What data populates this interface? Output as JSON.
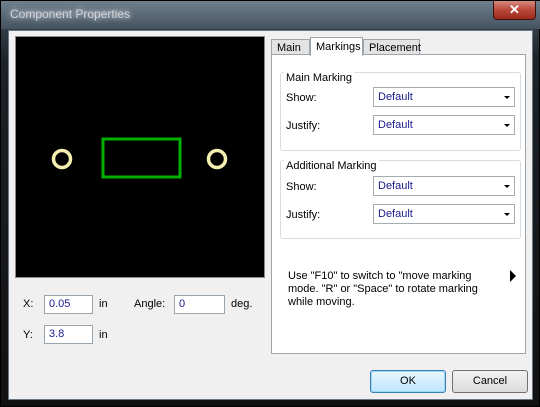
{
  "window": {
    "title": "Component Properties",
    "close_glyph": "✕"
  },
  "coords": {
    "x_label": "X:",
    "x_value": "0.05",
    "x_unit": "in",
    "y_label": "Y:",
    "y_value": "3.8",
    "y_unit": "in",
    "angle_label": "Angle:",
    "angle_value": "0",
    "angle_unit": "deg."
  },
  "tabs": [
    {
      "label": "Main",
      "active": false
    },
    {
      "label": "Markings",
      "active": true
    },
    {
      "label": "Placement",
      "active": false
    }
  ],
  "main_marking": {
    "title": "Main Marking",
    "show_label": "Show:",
    "show_value": "Default",
    "justify_label": "Justify:",
    "justify_value": "Default"
  },
  "additional_marking": {
    "title": "Additional Marking",
    "show_label": "Show:",
    "show_value": "Default",
    "justify_label": "Justify:",
    "justify_value": "Default"
  },
  "hint": {
    "line1": "Use \"F10\" to switch to \"move marking",
    "line2": "mode. \"R\" or \"Space\" to rotate marking",
    "line3": "while moving."
  },
  "buttons": {
    "ok": "OK",
    "cancel": "Cancel"
  },
  "colors": {
    "pad": "#f5f0b0",
    "outline": "#00b000",
    "preview_bg": "#000000"
  }
}
